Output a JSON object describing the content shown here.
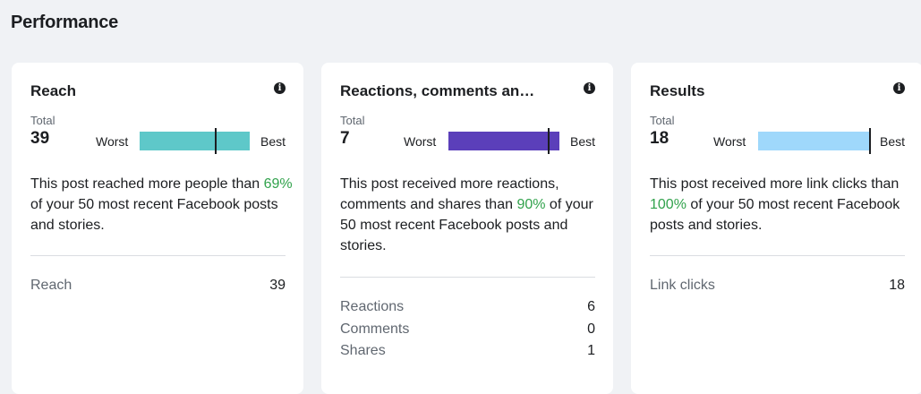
{
  "page": {
    "section_title": "Performance"
  },
  "cards": [
    {
      "title": "Reach",
      "info_icon": "info-icon",
      "total_label": "Total",
      "total_value": "39",
      "worst_label": "Worst",
      "best_label": "Best",
      "bar_color": "#5ec8c9",
      "percentile": 69,
      "description_prefix": "This post reached more people than ",
      "description_pct": "69%",
      "description_suffix": " of your 50 most recent Facebook posts and stories.",
      "metrics": [
        {
          "label": "Reach",
          "value": "39"
        }
      ]
    },
    {
      "title": "Reactions, comments an…",
      "info_icon": "info-icon",
      "total_label": "Total",
      "total_value": "7",
      "worst_label": "Worst",
      "best_label": "Best",
      "bar_color": "#5b3fba",
      "percentile": 90,
      "description_prefix": "This post received more reactions, comments and shares than ",
      "description_pct": "90%",
      "description_suffix": " of your 50 most recent Facebook posts and stories.",
      "metrics": [
        {
          "label": "Reactions",
          "value": "6"
        },
        {
          "label": "Comments",
          "value": "0"
        },
        {
          "label": "Shares",
          "value": "1"
        }
      ]
    },
    {
      "title": "Results",
      "info_icon": "info-icon",
      "total_label": "Total",
      "total_value": "18",
      "worst_label": "Worst",
      "best_label": "Best",
      "bar_color": "#9fd8fb",
      "percentile": 100,
      "description_prefix": "This post received more link clicks than ",
      "description_pct": "100%",
      "description_suffix": " of your 50 most recent Facebook posts and stories.",
      "metrics": [
        {
          "label": "Link clicks",
          "value": "18"
        }
      ]
    }
  ],
  "colors": {
    "accent_green": "#31a24c",
    "background": "#f0f2f5",
    "card": "#ffffff"
  }
}
